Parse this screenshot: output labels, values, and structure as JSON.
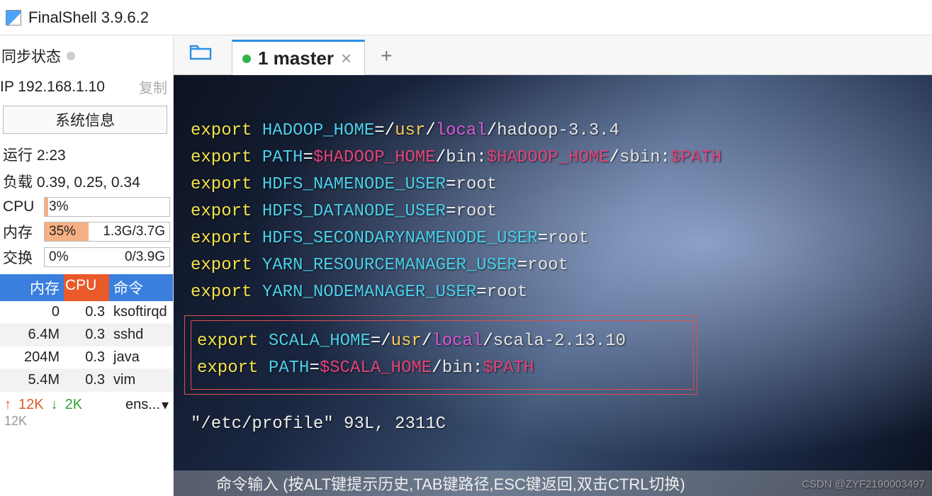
{
  "title": "FinalShell 3.9.6.2",
  "sidebar": {
    "sync_label": "同步状态",
    "ip_label": "IP 192.168.1.10",
    "copy_label": "复制",
    "sysinfo_btn": "系统信息",
    "uptime": "运行 2:23",
    "load": "负载 0.39, 0.25, 0.34",
    "cpu_label": "CPU",
    "cpu_pct": "3%",
    "mem_label": "内存",
    "mem_pct": "35%",
    "mem_detail": "1.3G/3.7G",
    "swap_label": "交换",
    "swap_pct": "0%",
    "swap_detail": "0/3.9G",
    "proc_headers": {
      "mem": "内存",
      "cpu": "CPU",
      "cmd": "命令"
    },
    "procs": [
      {
        "mem": "0",
        "cpu": "0.3",
        "cmd": "ksoftirqd"
      },
      {
        "mem": "6.4M",
        "cpu": "0.3",
        "cmd": "sshd"
      },
      {
        "mem": "204M",
        "cpu": "0.3",
        "cmd": "java"
      },
      {
        "mem": "5.4M",
        "cpu": "0.3",
        "cmd": "vim"
      }
    ],
    "net_up": "12K",
    "net_dn": "2K",
    "net_if": "ens...",
    "bottom": "12K"
  },
  "tab": {
    "name": "1 master"
  },
  "terminal": {
    "lines": [
      [
        [
          "kw",
          "export "
        ],
        [
          "vr",
          "HADOOP_HOME"
        ],
        [
          "eq",
          "="
        ],
        [
          "sl",
          "/"
        ],
        [
          "fn",
          "usr"
        ],
        [
          "sl",
          "/"
        ],
        [
          "pl",
          "local"
        ],
        [
          "sl",
          "/"
        ],
        [
          "tx",
          "hadoop-3.3.4"
        ]
      ],
      [
        [
          "kw",
          "export "
        ],
        [
          "vr",
          "PATH"
        ],
        [
          "eq",
          "="
        ],
        [
          "varref",
          "$HADOOP_HOME"
        ],
        [
          "sl",
          "/"
        ],
        [
          "tx",
          "bin"
        ],
        [
          "eq",
          ":"
        ],
        [
          "varref",
          "$HADOOP_HOME"
        ],
        [
          "sl",
          "/"
        ],
        [
          "tx",
          "sbin"
        ],
        [
          "eq",
          ":"
        ],
        [
          "varref",
          "$PATH"
        ]
      ],
      [
        [
          "kw",
          "export "
        ],
        [
          "vr",
          "HDFS_NAMENODE_USER"
        ],
        [
          "eq",
          "="
        ],
        [
          "tx",
          "root"
        ]
      ],
      [
        [
          "kw",
          "export "
        ],
        [
          "vr",
          "HDFS_DATANODE_USER"
        ],
        [
          "eq",
          "="
        ],
        [
          "tx",
          "root"
        ]
      ],
      [
        [
          "kw",
          "export "
        ],
        [
          "vr",
          "HDFS_SECONDARYNAMENODE_USER"
        ],
        [
          "eq",
          "="
        ],
        [
          "tx",
          "root"
        ]
      ],
      [
        [
          "kw",
          "export "
        ],
        [
          "vr",
          "YARN_RESOURCEMANAGER_USER"
        ],
        [
          "eq",
          "="
        ],
        [
          "tx",
          "root"
        ]
      ],
      [
        [
          "kw",
          "export "
        ],
        [
          "vr",
          "YARN_NODEMANAGER_USER"
        ],
        [
          "eq",
          "="
        ],
        [
          "tx",
          "root"
        ]
      ]
    ],
    "box_lines": [
      [
        [
          "kw",
          "export "
        ],
        [
          "vr",
          "SCALA_HOME"
        ],
        [
          "eq",
          "="
        ],
        [
          "sl",
          "/"
        ],
        [
          "fn",
          "usr"
        ],
        [
          "sl",
          "/"
        ],
        [
          "pl",
          "local"
        ],
        [
          "sl",
          "/"
        ],
        [
          "tx",
          "scala-2.13.10"
        ]
      ],
      [
        [
          "kw",
          "export "
        ],
        [
          "vr",
          "PATH"
        ],
        [
          "eq",
          "="
        ],
        [
          "varref",
          "$SCALA_HOME"
        ],
        [
          "sl",
          "/"
        ],
        [
          "tx",
          "bin"
        ],
        [
          "eq",
          ":"
        ],
        [
          "varref",
          "$PATH"
        ]
      ]
    ],
    "status": "\"/etc/profile\" 93L, 2311C",
    "hint": "命令输入 (按ALT键提示历史,TAB键路径,ESC键返回,双击CTRL切换)",
    "watermark": "CSDN @ZYF2190003497"
  }
}
